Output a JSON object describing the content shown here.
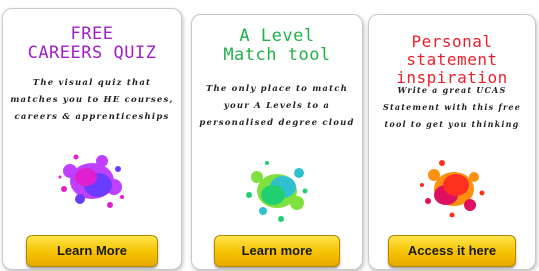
{
  "cards": [
    {
      "title_line1": "FREE",
      "title_line2": "CAREERS QUIZ",
      "desc_lines": [
        "The visual quiz that",
        "matches you to HE courses,",
        "careers & apprenticeships"
      ],
      "button_label": "Learn More",
      "accent": "#a020c8",
      "splash_colors": [
        "#e020d0",
        "#6a3cff",
        "#c040ff"
      ]
    },
    {
      "title_line1": "A Level",
      "title_line2": "Match tool",
      "desc_lines": [
        "The only place to match",
        "your A Levels to a",
        "personalised degree cloud"
      ],
      "button_label": "Learn more",
      "accent": "#22b04a",
      "splash_colors": [
        "#20d070",
        "#30c0d0",
        "#80e040"
      ]
    },
    {
      "title_line1": "Personal statement",
      "title_line2": "inspiration",
      "desc_lines": [
        "Write a great UCAS",
        "Statement with this free",
        "tool to get you thinking"
      ],
      "button_label": "Access it here",
      "accent": "#e8222c",
      "splash_colors": [
        "#ff3020",
        "#ff9010",
        "#e01060"
      ]
    }
  ]
}
